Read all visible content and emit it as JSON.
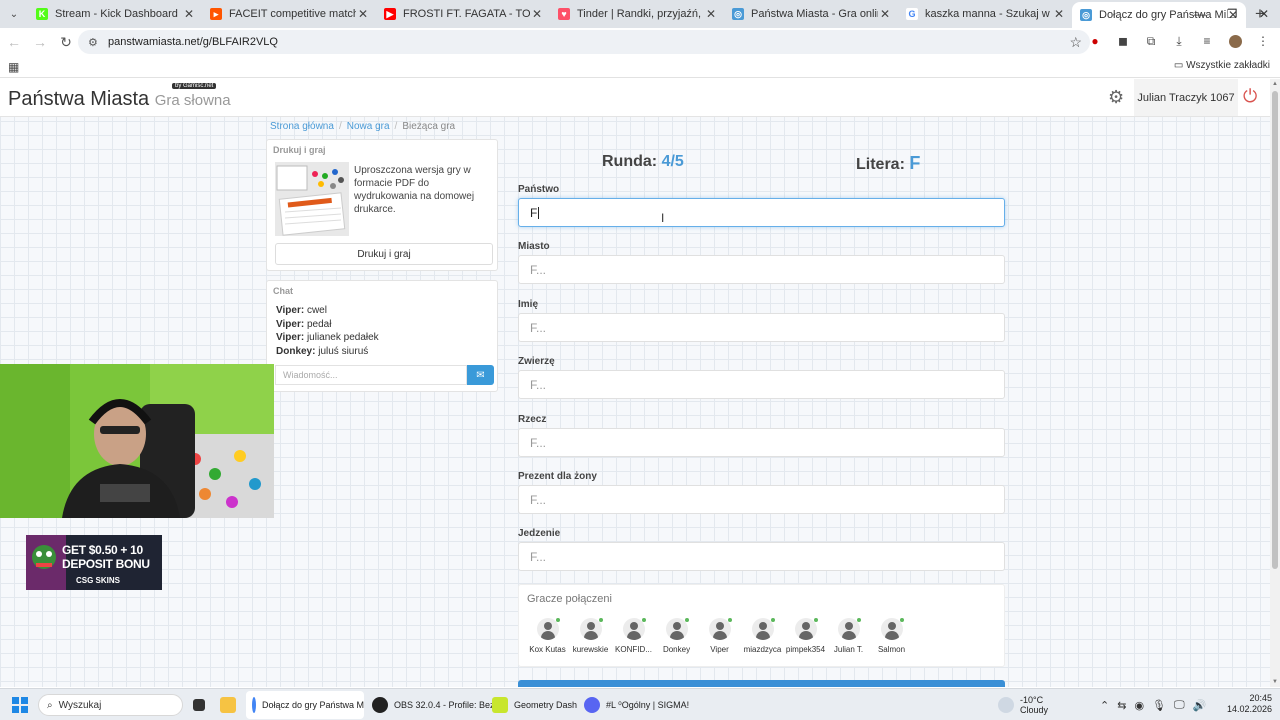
{
  "browser": {
    "tabs": [
      {
        "title": "Stream - Kick Dashboard",
        "color": "#53fc18",
        "glyph": "K"
      },
      {
        "title": "FACEIT competitive match - FACEIT",
        "color": "#ff5500",
        "glyph": "▸"
      },
      {
        "title": "FROSTI FT. FAGATA - TOXIC - YouTube",
        "color": "#ff0000",
        "glyph": "▶"
      },
      {
        "title": "Tinder | Randki, przyjaźń, nowe znajomości",
        "color": "#fd5068",
        "glyph": "♥"
      },
      {
        "title": "Państwa Miasta - Gra online",
        "color": "#4a9ad6",
        "glyph": "◎"
      },
      {
        "title": "kaszka manna - Szukaj w Google",
        "color": "#ffffff",
        "glyph": "G"
      },
      {
        "title": "Dołącz do gry Państwa Miasta",
        "color": "#4a9ad6",
        "glyph": "◎"
      }
    ],
    "url": "panstwamiasta.net/g/BLFAIR2VLQ",
    "bookmarks_all": "Wszystkie zakładki"
  },
  "site": {
    "brand": "Państwa Miasta",
    "brand_sub": "Gra słowna",
    "by": "by Gamisc.net",
    "user": "Julian Traczyk 1067"
  },
  "breadcrumb": [
    "Strona główna",
    "Nowa gra",
    "Bieżąca gra"
  ],
  "print": {
    "title": "Drukuj i graj",
    "text": "Uproszczona wersja gry w formacie PDF do wydrukowania na domowej drukarce.",
    "button": "Drukuj i graj"
  },
  "chat": {
    "title": "Chat",
    "messages": [
      {
        "user": "Viper:",
        "text": "cwel"
      },
      {
        "user": "Viper:",
        "text": "pedał"
      },
      {
        "user": "Viper:",
        "text": "julianek pedałek"
      },
      {
        "user": "Donkey:",
        "text": "juluś siuruś"
      }
    ],
    "placeholder": "Wiadomość..."
  },
  "ad": {
    "line1": "GET $0.50 + 10",
    "line2": "DEPOSIT BONU",
    "brand": "CSG SKINS"
  },
  "game": {
    "round_label": "Runda:",
    "round_value": "4/5",
    "letter_label": "Litera:",
    "letter_value": "F",
    "fields": [
      {
        "label": "Państwo",
        "value": "F",
        "placeholder": ""
      },
      {
        "label": "Miasto",
        "value": "",
        "placeholder": "F..."
      },
      {
        "label": "Imię",
        "value": "",
        "placeholder": "F..."
      },
      {
        "label": "Zwierzę",
        "value": "",
        "placeholder": "F..."
      },
      {
        "label": "Rzecz",
        "value": "",
        "placeholder": "F..."
      },
      {
        "label": "Prezent dla żony",
        "value": "",
        "placeholder": "F..."
      },
      {
        "label": "Jedzenie",
        "value": "",
        "placeholder": "F..."
      }
    ]
  },
  "players": {
    "title": "Gracze połączeni",
    "list": [
      "Kox Kutas",
      "kurewskie",
      "KONFID...",
      "Donkey",
      "Viper",
      "miazdzyca",
      "pimpek354",
      "Julian T.",
      "Salmon"
    ]
  },
  "taskbar": {
    "search": "Wyszukaj",
    "apps": [
      {
        "label": "Dołącz do gry Państwa M"
      },
      {
        "label": "OBS 32.0.4 - Profile: Bez"
      },
      {
        "label": "Geometry Dash"
      },
      {
        "label": "#L  ⁰Ogólny | SIGMA!"
      }
    ],
    "weather_temp": "-10°C",
    "weather_desc": "Cloudy",
    "time": "20:45",
    "date": "14.02.2026"
  }
}
